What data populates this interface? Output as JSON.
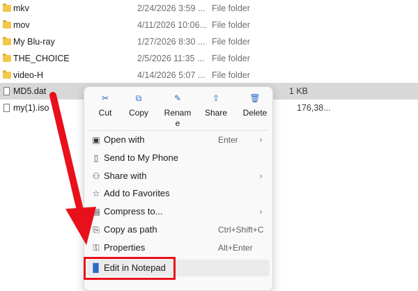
{
  "files": [
    {
      "name": "mkv",
      "date": "2/24/2026 3:59 ...",
      "type": "File folder",
      "size": "",
      "icon": "folder-icon"
    },
    {
      "name": "mov",
      "date": "4/11/2026 10:06...",
      "type": "File folder",
      "size": "",
      "icon": "folder-icon"
    },
    {
      "name": "My Blu-ray",
      "date": "1/27/2026 8:30 ...",
      "type": "File folder",
      "size": "",
      "icon": "folder-icon"
    },
    {
      "name": "THE_CHOICE",
      "date": "2/5/2026 11:35 ...",
      "type": "File folder",
      "size": "",
      "icon": "folder-icon"
    },
    {
      "name": "video-H",
      "date": "4/14/2026 5:07 ...",
      "type": "File folder",
      "size": "",
      "icon": "folder-icon"
    },
    {
      "name": "MD5.dat",
      "date": "",
      "type": "",
      "size": "1 KB",
      "icon": "document-icon",
      "selected": true
    },
    {
      "name": "my(1).iso",
      "date": "",
      "type": "",
      "size": "176,38...",
      "icon": "document-icon"
    }
  ],
  "context_menu": {
    "actions": [
      {
        "label": "Cut",
        "icon": "cut-icon"
      },
      {
        "label": "Copy",
        "icon": "copy-icon"
      },
      {
        "label": "Rename",
        "icon": "rename-icon"
      },
      {
        "label": "Share",
        "icon": "share-icon"
      },
      {
        "label": "Delete",
        "icon": "delete-icon"
      }
    ],
    "rename_parts": [
      "Renam",
      "e"
    ],
    "items": [
      {
        "label": "Open with",
        "shortcut": "Enter",
        "submenu": true,
        "icon": "open-with-icon"
      },
      {
        "label": "Send to My Phone",
        "shortcut": "",
        "submenu": false,
        "icon": "phone-icon"
      },
      {
        "label": "Share with",
        "shortcut": "",
        "submenu": true,
        "icon": "share-with-icon"
      },
      {
        "label": "Add to Favorites",
        "shortcut": "",
        "submenu": false,
        "icon": "star-icon"
      },
      {
        "label": "Compress to...",
        "shortcut": "",
        "submenu": true,
        "icon": "compress-icon"
      },
      {
        "label": "Copy as path",
        "shortcut": "Ctrl+Shift+C",
        "submenu": false,
        "icon": "copy-path-icon"
      },
      {
        "label": "Properties",
        "shortcut": "Alt+Enter",
        "submenu": false,
        "icon": "properties-icon"
      },
      {
        "label": "Edit in Notepad",
        "shortcut": "",
        "submenu": false,
        "icon": "notepad-icon",
        "highlighted": true
      }
    ]
  },
  "annotation_color": "#e8101b"
}
